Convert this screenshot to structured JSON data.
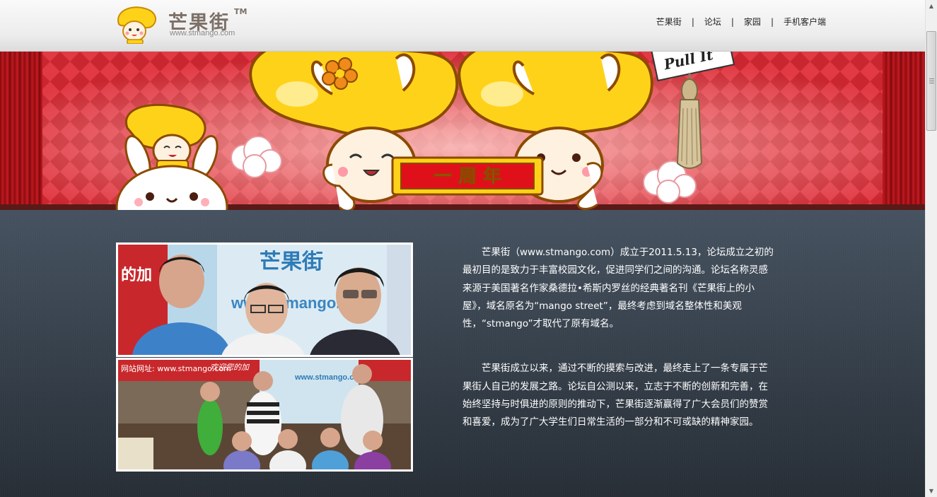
{
  "header": {
    "logo_text": "芒果街",
    "logo_tm": "TM",
    "logo_url": "www.stmango.com",
    "nav": [
      {
        "label": "芒果街"
      },
      {
        "label": "论坛"
      },
      {
        "label": "家园"
      },
      {
        "label": "手机客户端"
      }
    ],
    "nav_separator": "|"
  },
  "banner": {
    "ribbon_text": "一 周 年",
    "sign_text": "Pull It"
  },
  "photos": {
    "top_sign_text": "芒果街",
    "top_banner_text": "www.stmango.com",
    "top_side_text": "的加",
    "bottom_site_label": "网站网址: www.stmango.com",
    "bottom_welcome": "欢迎您的加",
    "bottom_url": "www.stmango.com"
  },
  "content": {
    "paragraph_1": "芒果街（www.stmango.com）成立于2011.5.13，论坛成立之初的最初目的是致力于丰富校园文化，促进同学们之间的沟通。论坛名称灵感来源于美国著名作家桑德拉•希斯内罗丝的经典著名刊《芒果街上的小屋》，域名原名为“mango street”，最终考虑到域名整体性和美观性，“stmango”才取代了原有域名。",
    "paragraph_2": "芒果街成立以来，通过不断的摸索与改进，最终走上了一条专属于芒果街人自己的发展之路。论坛自公测以来，立志于不断的创新和完善，在始终坚持与时俱进的原则的推动下，芒果街逐渐赢得了广大会员们的赞赏和喜爱，成为了广大学生们日常生活的一部分和不可或缺的精神家园。"
  },
  "colors": {
    "curtain_red": "#b0141a",
    "mango_yellow": "#ffd21a",
    "ribbon_red": "#e0101a",
    "content_bg": "#36404b"
  },
  "scrollbar": {
    "up_icon": "triangle-up-icon",
    "down_icon": "triangle-down-icon"
  }
}
